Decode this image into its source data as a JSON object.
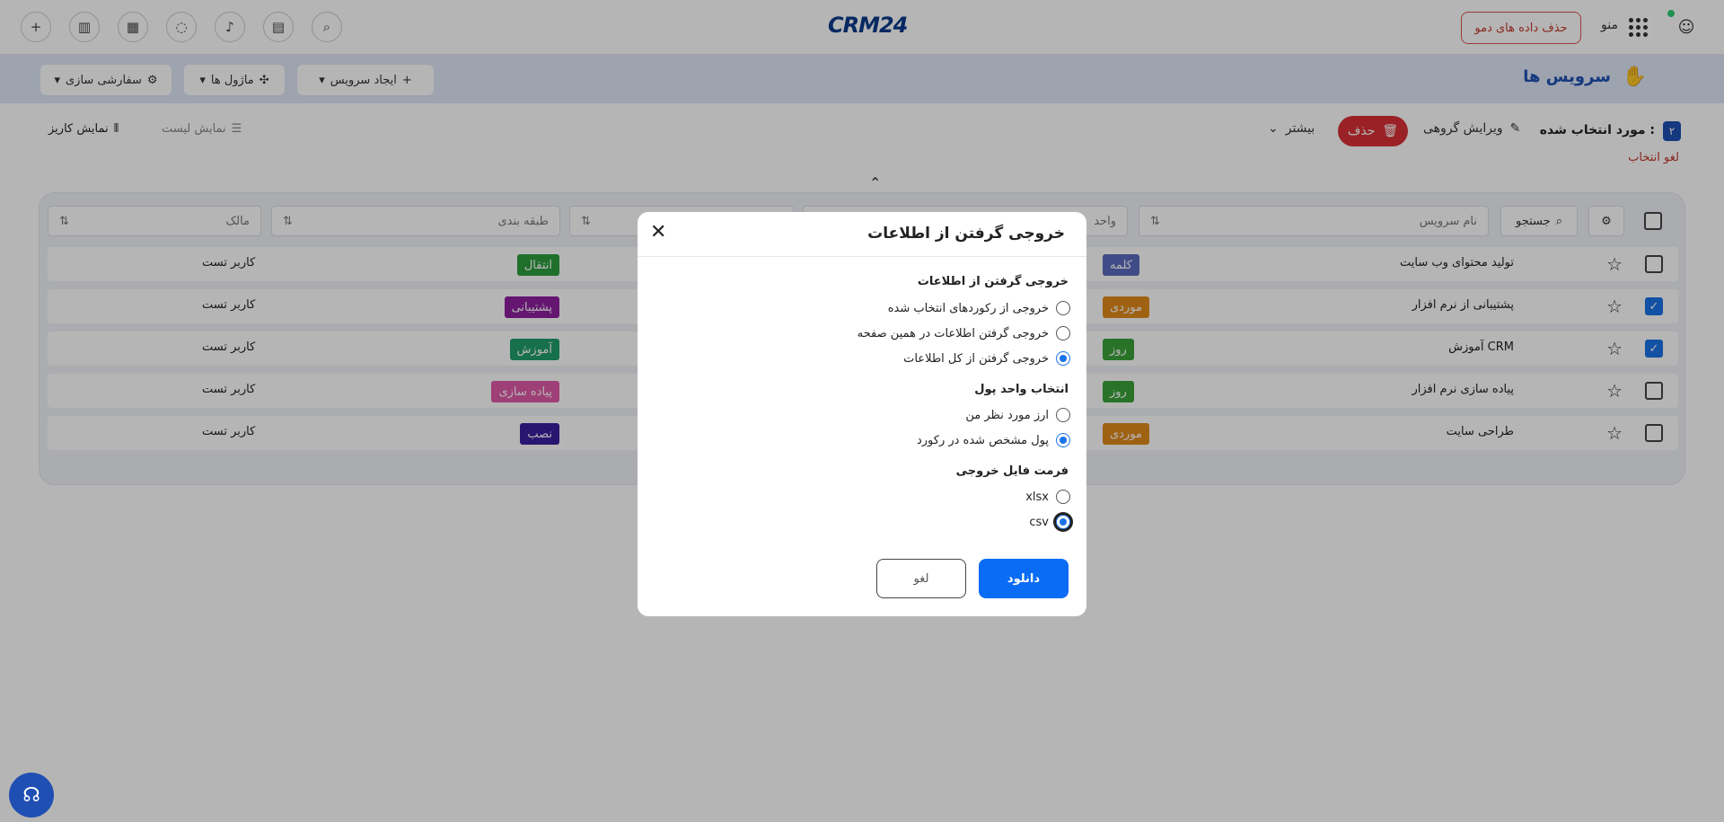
{
  "topbar": {
    "logo": "CRM24",
    "demo_button": "حذف داده های دمو",
    "menu_label": "منو"
  },
  "subbar": {
    "page_title": "سرویس ها",
    "create_service": "ایجاد سرویس",
    "modules": "ماژول ها",
    "customize": "سفارشی سازی"
  },
  "actions": {
    "selected_count": "۲",
    "selected_label": "مورد انتخاب شده :",
    "group_edit": "ویرایش گروهی",
    "delete": "حذف",
    "more": "بیشتر",
    "cancel_selection": "لغو انتخاب",
    "list_view": "نمایش لیست",
    "kanban_view": "نمایش کاریز"
  },
  "table": {
    "search_label": "جستجو",
    "headers": {
      "name": "نام سرویس",
      "unit": "واحد",
      "category": "طبقه بندی",
      "owner": "مالک"
    },
    "rows": [
      {
        "name": "تولید محتوای وب سایت",
        "unit": "کلمه",
        "unit_color": "#5b6bbf",
        "category": "انتقال",
        "category_color": "#2e9e3e",
        "owner": "کاربر تست",
        "checked": false
      },
      {
        "name": "پشتیبانی از نرم افزار",
        "unit": "موردی",
        "unit_color": "#e08a1c",
        "category": "پشتیبانی",
        "category_color": "#8e1fa0",
        "owner": "کاربر تست",
        "checked": true
      },
      {
        "name": "آموزش CRM",
        "unit": "روز",
        "unit_color": "#3aa33a",
        "category": "آموزش",
        "category_color": "#1f9e6a",
        "owner": "کاربر تست",
        "checked": true
      },
      {
        "name": "پیاده سازی نرم افزار",
        "unit": "روز",
        "unit_color": "#3aa33a",
        "category": "پیاده سازی",
        "category_color": "#e05aa8",
        "owner": "کاربر تست",
        "checked": false
      },
      {
        "name": "طراحی سایت",
        "unit": "موردی",
        "unit_color": "#e08a1c",
        "category": "نصب",
        "category_color": "#3b1fa0",
        "owner": "کاربر تست",
        "checked": false
      }
    ]
  },
  "modal": {
    "title": "خروجی گرفتن از اطلاعات",
    "export_section": "خروجی گرفتن از اطلاعات",
    "export_options": [
      "خروجی از رکوردهای انتخاب شده",
      "خروجی گرفتن اطلاعات در همین صفحه",
      "خروجی گرفتن از کل اطلاعات"
    ],
    "export_selected": 2,
    "currency_section": "انتخاب واحد پول",
    "currency_options": [
      "ارز مورد نظر من",
      "پول مشخص شده در رکورد"
    ],
    "currency_selected": 1,
    "format_section": "فرمت فایل خروجی",
    "format_options": [
      "xlsx",
      "csv"
    ],
    "format_selected": 1,
    "download_button": "دانلود",
    "cancel_button": "لغو"
  },
  "icons": {
    "add": "plus-circle-icon",
    "reports": "bar-chart-icon",
    "calendar": "calendar-icon",
    "chat": "chat-icon",
    "notifications": "bell-icon",
    "tasks": "clipboard-icon",
    "search": "search-icon",
    "user": "user-icon"
  }
}
